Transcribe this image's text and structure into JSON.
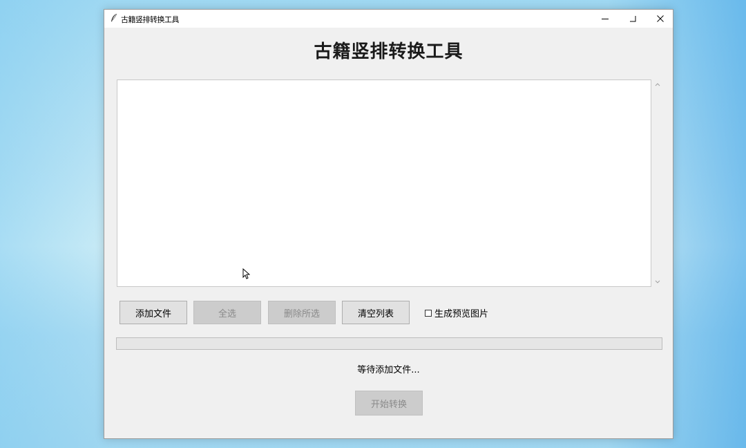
{
  "window": {
    "title": "古籍竖排转换工具",
    "accent": "#f0f0f0"
  },
  "main": {
    "heading": "古籍竖排转换工具",
    "file_list": []
  },
  "toolbar": {
    "add_file_label": "添加文件",
    "select_all_label": "全选",
    "delete_selected_label": "删除所选",
    "clear_list_label": "清空列表",
    "preview_checkbox_label": "生成预览图片",
    "preview_checked": false
  },
  "progress": {
    "value": 0
  },
  "status": {
    "text": "等待添加文件..."
  },
  "actions": {
    "start_label": "开始转换"
  },
  "icons": {
    "app": "feather-icon",
    "minimize": "minimize-icon",
    "maximize": "maximize-icon",
    "close": "close-icon",
    "scroll_up": "chevron-up-icon",
    "scroll_down": "chevron-down-icon"
  }
}
